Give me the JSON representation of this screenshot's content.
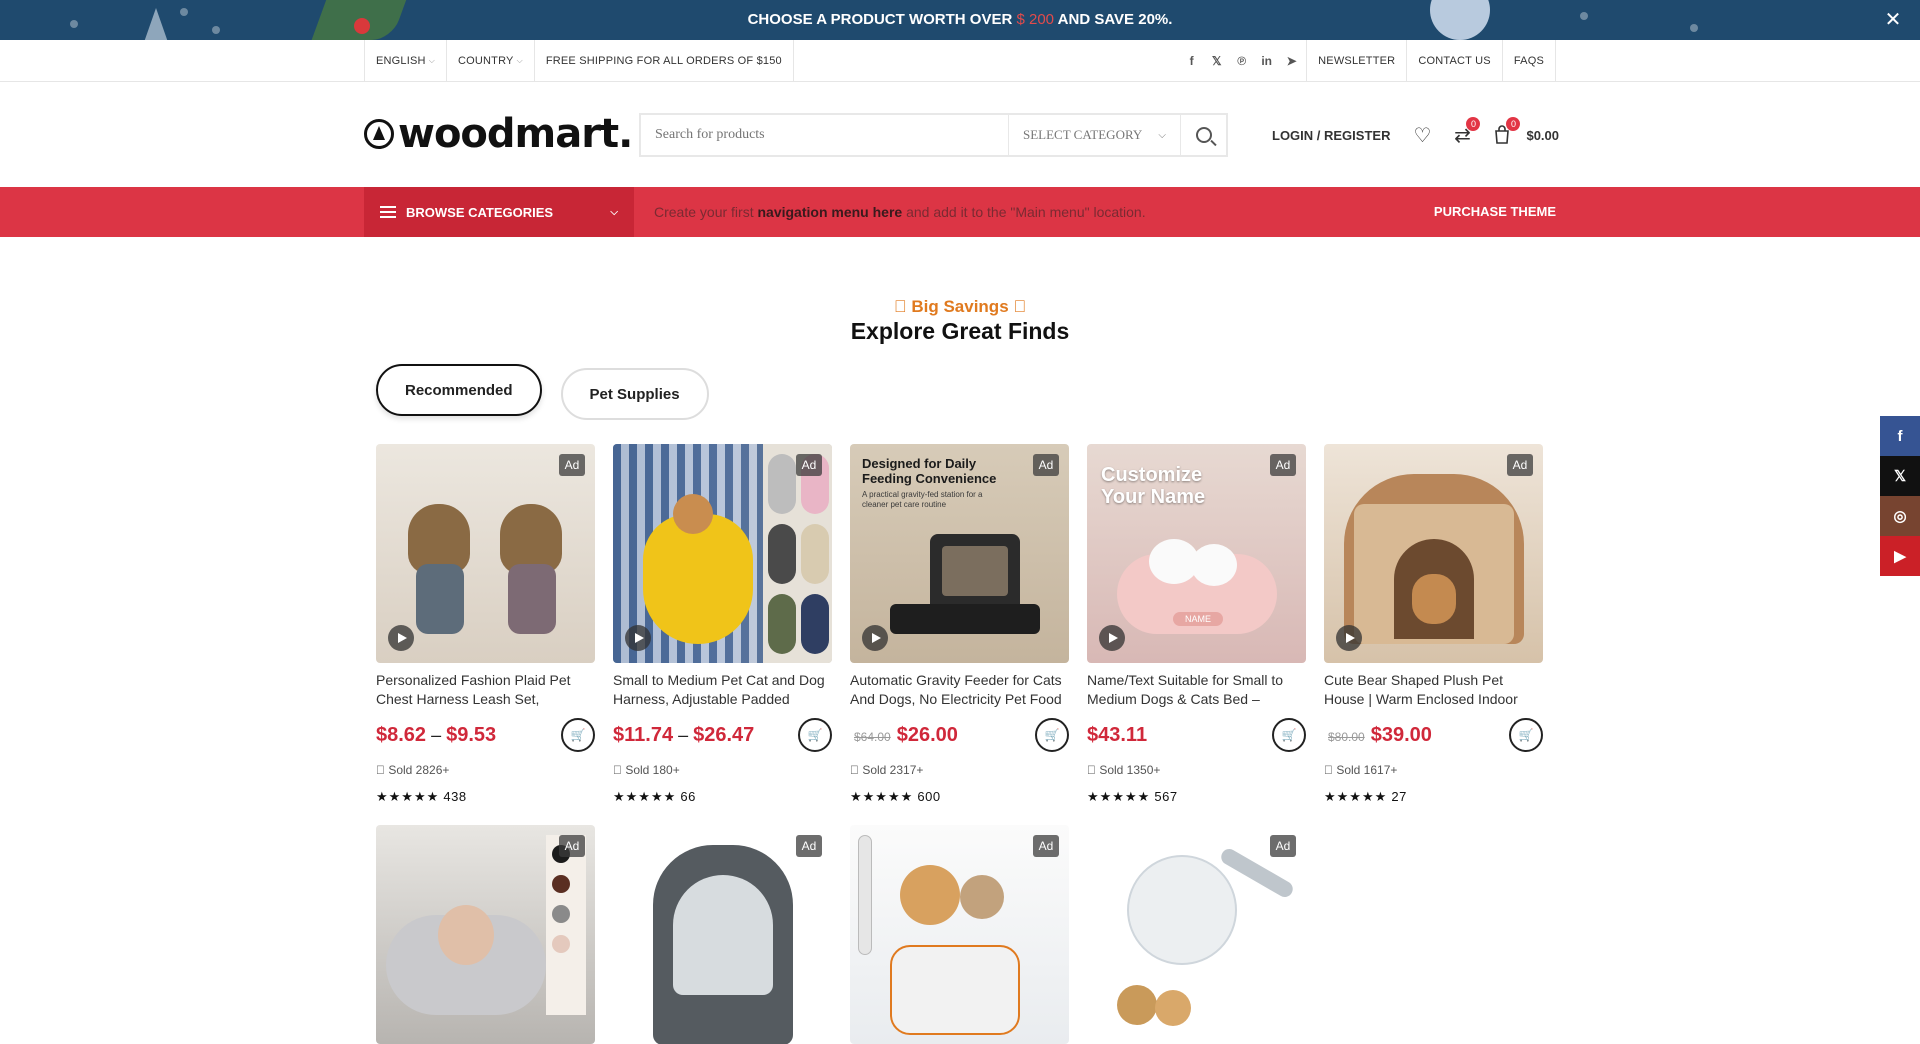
{
  "promo": {
    "text_before": "CHOOSE A PRODUCT WORTH OVER",
    "price": "$ 200",
    "text_after": "AND SAVE 20%.",
    "close_icon": "close-icon"
  },
  "topbar": {
    "language": "ENGLISH",
    "country": "COUNTRY",
    "shipping": "FREE SHIPPING FOR ALL ORDERS OF $150",
    "socials": [
      "facebook-icon",
      "x-icon",
      "pinterest-icon",
      "linkedin-icon",
      "telegram-icon"
    ],
    "links": [
      "NEWSLETTER",
      "CONTACT US",
      "FAQS"
    ]
  },
  "header": {
    "logo": "woodmart.",
    "search_placeholder": "Search for products",
    "select_category": "SELECT CATEGORY",
    "login": "LOGIN / REGISTER",
    "compare_count": "0",
    "cart_count": "0",
    "cart_total": "$0.00"
  },
  "nav": {
    "browse": "BROWSE CATEGORIES",
    "msg_before": "Create your first",
    "msg_link": "navigation menu here",
    "msg_after": "and add it to the \"Main menu\" location.",
    "purchase": "PURCHASE THEME",
    "accent": "#dc3545"
  },
  "section": {
    "eyebrow": "\u0000 Big Savings \u0000",
    "title": "Explore Great Finds",
    "tabs": [
      "Recommended",
      "Pet Supplies"
    ]
  },
  "products": [
    {
      "name": "Personalized Fashion Plaid Pet Chest Harness Leash Set,",
      "price_from": "$8.62",
      "price_to": "$9.53",
      "old_price": "",
      "price": "",
      "sold": "\u0000 Sold 2826+",
      "stars": "★★★★★",
      "reviews": "438",
      "ad": "Ad"
    },
    {
      "name": "Small to Medium Pet Cat and Dog Harness, Adjustable Padded",
      "price_from": "$11.74",
      "price_to": "$26.47",
      "old_price": "",
      "price": "",
      "sold": "\u0000 Sold 180+",
      "stars": "★★★★★",
      "reviews": "66",
      "ad": "Ad"
    },
    {
      "name": "Automatic Gravity Feeder for Cats And Dogs, No Electricity Pet Food",
      "price_from": "",
      "price_to": "",
      "old_price": "$64.00",
      "price": "$26.00",
      "sold": "\u0000 Sold 2317+",
      "stars": "★★★★★",
      "reviews": "600",
      "ad": "Ad",
      "image_text_1": "Designed for Daily Feeding Convenience",
      "image_text_2": "A practical gravity-fed station for a cleaner pet care routine"
    },
    {
      "name": "Name/Text Suitable for Small to Medium Dogs & Cats Bed –",
      "price_from": "",
      "price_to": "",
      "old_price": "",
      "price": "$43.11",
      "sold": "\u0000 Sold 1350+",
      "stars": "★★★★★",
      "reviews": "567",
      "ad": "Ad",
      "image_text_1": "Customize Your Name",
      "image_text_2": "NAME"
    },
    {
      "name": "Cute Bear Shaped Plush Pet House | Warm Enclosed Indoor",
      "price_from": "",
      "price_to": "",
      "old_price": "$80.00",
      "price": "$39.00",
      "sold": "\u0000 Sold 1617+",
      "stars": "★★★★★",
      "reviews": "27",
      "ad": "Ad"
    },
    {
      "name": "",
      "ad": "Ad"
    },
    {
      "name": "",
      "ad": "Ad"
    },
    {
      "name": "",
      "ad": "Ad"
    },
    {
      "name": "",
      "ad": "Ad"
    }
  ],
  "side_socials": [
    {
      "icon": "facebook-icon",
      "color": "#365493"
    },
    {
      "icon": "x-icon",
      "color": "#111111"
    },
    {
      "icon": "instagram-icon",
      "color": "#774430"
    },
    {
      "icon": "youtube-icon",
      "color": "#cb2027"
    }
  ]
}
